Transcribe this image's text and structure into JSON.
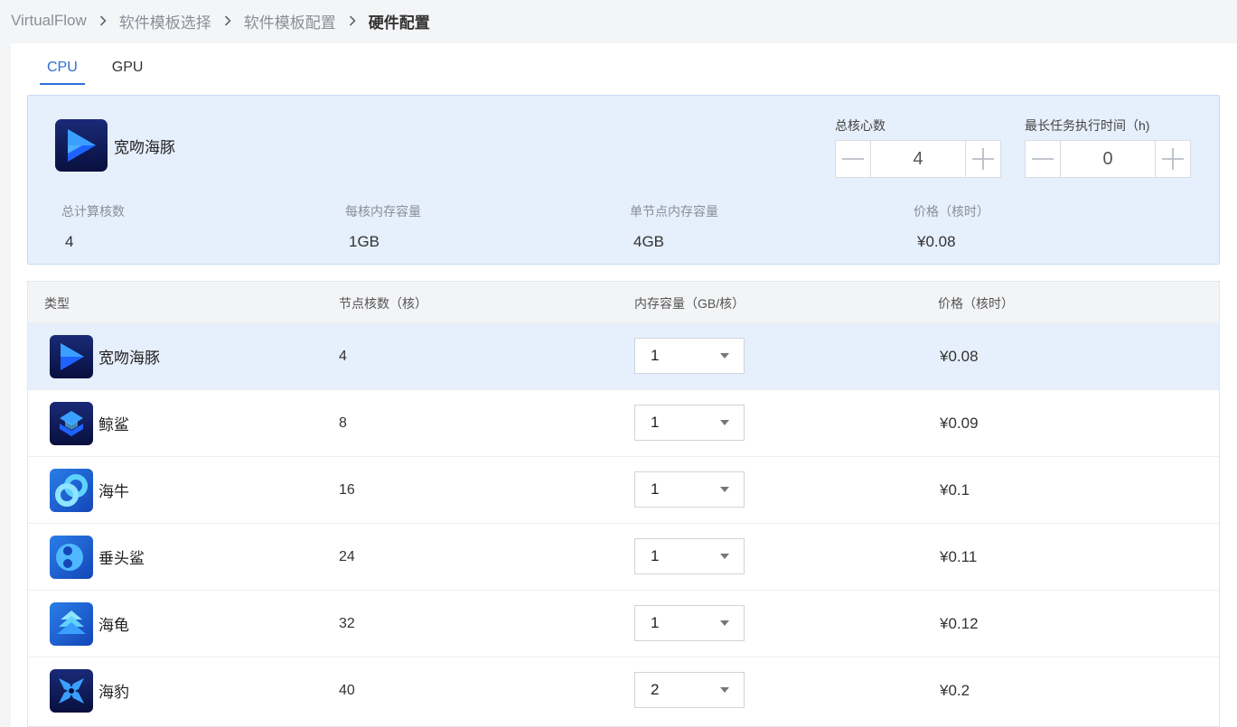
{
  "breadcrumb": {
    "items": [
      "VirtualFlow",
      "软件模板选择",
      "软件模板配置",
      "硬件配置"
    ]
  },
  "tabs": [
    {
      "label": "CPU",
      "active": true
    },
    {
      "label": "GPU",
      "active": false
    }
  ],
  "summary": {
    "app_name": "宽吻海豚",
    "total_cores": {
      "label": "总核心数",
      "value": "4"
    },
    "max_runtime": {
      "label": "最长任务执行时间（h)",
      "value": "0"
    },
    "stats": [
      {
        "label": "总计算核数",
        "value": "4"
      },
      {
        "label": "每核内存容量",
        "value": "1GB"
      },
      {
        "label": "单节点内存容量",
        "value": "4GB"
      },
      {
        "label": "价格（核时）",
        "value": "¥0.08"
      }
    ]
  },
  "table": {
    "headers": [
      "类型",
      "节点核数（核）",
      "内存容量（GB/核）",
      "价格（核时）"
    ],
    "rows": [
      {
        "name": "宽吻海豚",
        "cores": "4",
        "memory": "1",
        "price": "¥0.08",
        "icon": "play-icon",
        "selected": true
      },
      {
        "name": "鲸鲨",
        "cores": "8",
        "memory": "1",
        "price": "¥0.09",
        "icon": "cube-icon",
        "selected": false
      },
      {
        "name": "海牛",
        "cores": "16",
        "memory": "1",
        "price": "¥0.1",
        "icon": "rings-icon",
        "selected": false
      },
      {
        "name": "垂头鲨",
        "cores": "24",
        "memory": "1",
        "price": "¥0.11",
        "icon": "eight-icon",
        "selected": false
      },
      {
        "name": "海龟",
        "cores": "32",
        "memory": "1",
        "price": "¥0.12",
        "icon": "stack-icon",
        "selected": false
      },
      {
        "name": "海豹",
        "cores": "40",
        "memory": "2",
        "price": "¥0.2",
        "icon": "cross-icon",
        "selected": false
      }
    ]
  },
  "colors": {
    "accent": "#2b6fd6",
    "summary_bg": "#e6effc",
    "icon_dark": "#0d1a5c",
    "icon_light": "#3aa0ff"
  }
}
